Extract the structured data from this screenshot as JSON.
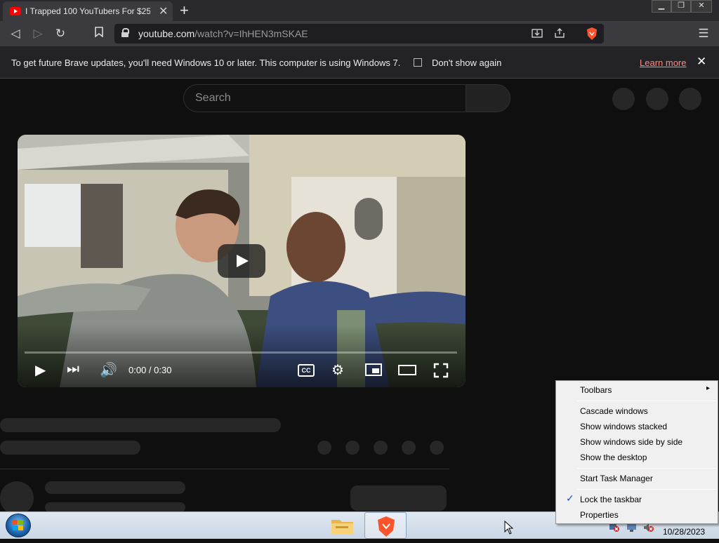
{
  "browser": {
    "tab_title": "I Trapped 100 YouTubers For $25,",
    "new_tab_label": "+",
    "url_host": "youtube.com",
    "url_path": "/watch?v=IhHEN3mSKAE"
  },
  "infobar": {
    "message": "To get future Brave updates, you'll need Windows 10 or later. This computer is using Windows 7.",
    "checkbox_label": "Don't show again",
    "learn_more": "Learn more"
  },
  "youtube": {
    "search_placeholder": "Search",
    "player": {
      "time": "0:00 / 0:30",
      "cc_label": "CC"
    }
  },
  "context_menu": {
    "items": [
      "Toolbars",
      "Cascade windows",
      "Show windows stacked",
      "Show windows side by side",
      "Show the desktop",
      "Start Task Manager",
      "Lock the taskbar",
      "Properties"
    ],
    "checked_item": "Lock the taskbar"
  },
  "taskbar": {
    "date": "10/28/2023"
  },
  "colors": {
    "youtube_red": "#ff0000",
    "brave_orange": "#fb542b",
    "link_color": "#ff8a80"
  }
}
